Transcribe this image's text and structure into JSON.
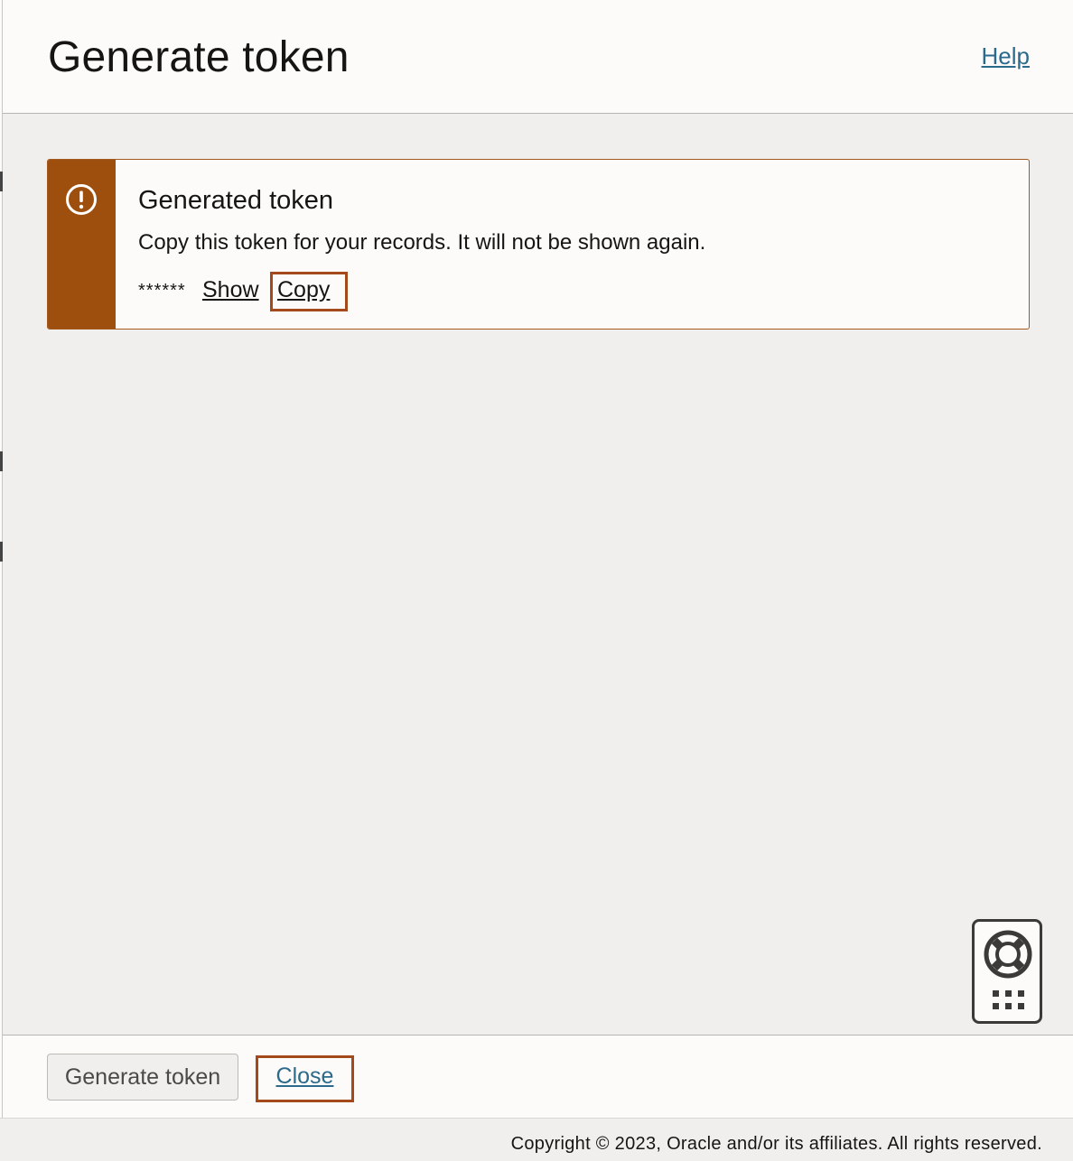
{
  "panel": {
    "title": "Generate token",
    "help_label": "Help"
  },
  "alert": {
    "title": "Generated token",
    "message": "Copy this token for your records. It will not be shown again.",
    "token_masked": "******",
    "show_label": "Show",
    "copy_label": "Copy",
    "icon": "exclamation-circle-icon",
    "accent_color": "#9e4f0d"
  },
  "help_widget": {
    "icons": [
      "lifebuoy-icon",
      "grid-icon"
    ]
  },
  "footer": {
    "generate_label": "Generate token",
    "close_label": "Close"
  },
  "copyright": "Copyright © 2023, Oracle and/or its affiliates. All rights reserved.",
  "colors": {
    "link": "#2b6a8a",
    "highlight_border": "#a3491a",
    "background": "#f1efed",
    "surface": "#fcfbfa"
  }
}
